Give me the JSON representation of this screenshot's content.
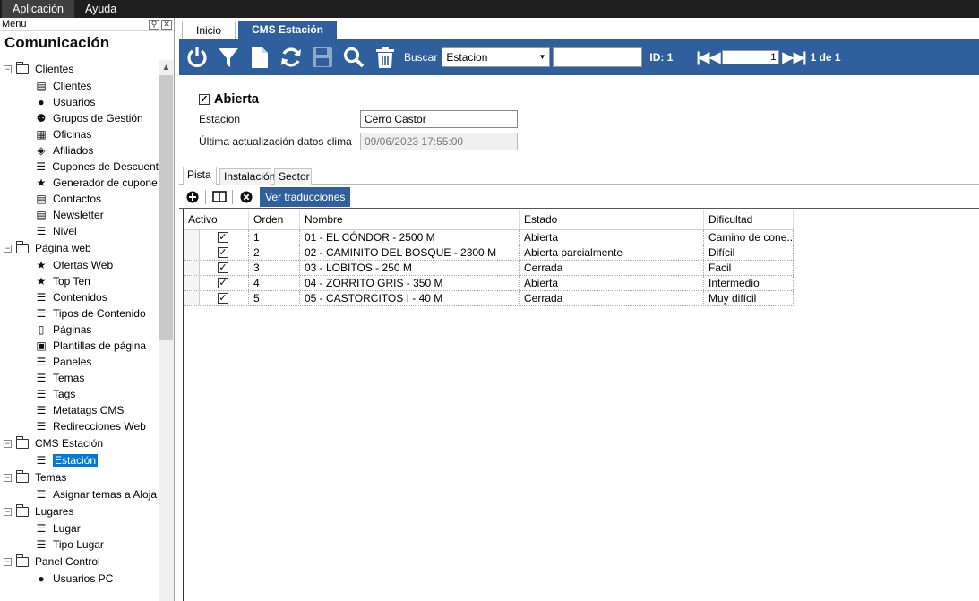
{
  "menubar": {
    "items": [
      "Aplicación",
      "Ayuda"
    ]
  },
  "left_panel": {
    "header": "Menu",
    "title": "Comunicación",
    "groups": [
      {
        "label": "Clientes",
        "items": [
          {
            "label": "Clientes",
            "icon": "client-card-icon"
          },
          {
            "label": "Usuarios",
            "icon": "user-icon"
          },
          {
            "label": "Grupos de Gestión",
            "icon": "group-icon"
          },
          {
            "label": "Oficinas",
            "icon": "building-icon"
          },
          {
            "label": "Afiliados",
            "icon": "affiliate-icon"
          },
          {
            "label": "Cupones de Descuent",
            "icon": "list-icon"
          },
          {
            "label": "Generador de cupone",
            "icon": "star-icon"
          },
          {
            "label": "Contactos",
            "icon": "client-card-icon"
          },
          {
            "label": "Newsletter",
            "icon": "client-card-icon"
          },
          {
            "label": "Nivel",
            "icon": "list-icon"
          }
        ]
      },
      {
        "label": "Página web",
        "items": [
          {
            "label": "Ofertas Web",
            "icon": "star-icon"
          },
          {
            "label": "Top Ten",
            "icon": "star-icon"
          },
          {
            "label": "Contenidos",
            "icon": "list-icon"
          },
          {
            "label": "Tipos de Contenido",
            "icon": "list-icon"
          },
          {
            "label": "Páginas",
            "icon": "page-icon"
          },
          {
            "label": "Plantillas de página",
            "icon": "template-icon"
          },
          {
            "label": "Paneles",
            "icon": "list-icon"
          },
          {
            "label": "Temas",
            "icon": "list-icon"
          },
          {
            "label": "Tags",
            "icon": "list-icon"
          },
          {
            "label": "Metatags CMS",
            "icon": "list-icon"
          },
          {
            "label": "Redirecciones Web",
            "icon": "list-icon"
          }
        ]
      },
      {
        "label": "CMS Estación",
        "items": [
          {
            "label": "Estación",
            "icon": "list-icon",
            "selected": true
          }
        ]
      },
      {
        "label": "Temas",
        "items": [
          {
            "label": "Asignar temas a Aloja",
            "icon": "list-icon"
          }
        ]
      },
      {
        "label": "Lugares",
        "items": [
          {
            "label": "Lugar",
            "icon": "list-icon"
          },
          {
            "label": "Tipo Lugar",
            "icon": "list-icon"
          }
        ]
      },
      {
        "label": "Panel Control",
        "items": [
          {
            "label": "Usuarios PC",
            "icon": "user-icon"
          }
        ]
      }
    ]
  },
  "main": {
    "tabs": [
      {
        "label": "Inicio"
      },
      {
        "label": "CMS Estación",
        "active": true
      }
    ],
    "toolbar": {
      "search_label": "Buscar",
      "search_field": "Estacion",
      "search_value": "",
      "id_label": "ID: 1",
      "page_value": "1",
      "page_of": "1 de 1",
      "color": "#2f5f9c"
    },
    "form": {
      "abierta_label": "Abierta",
      "abierta_checked": true,
      "estacion_label": "Estacion",
      "estacion_value": "Cerro Castor",
      "clima_label": "Última actualización datos clima",
      "clima_value": "09/06/2023 17:55:00"
    },
    "subtabs": [
      {
        "label": "Pista",
        "active": true
      },
      {
        "label": "Instalación"
      },
      {
        "label": "Sector"
      }
    ],
    "grid_toolbar": {
      "translations_button": "Ver traducciones"
    },
    "grid": {
      "columns": [
        "Activo",
        "Orden",
        "Nombre",
        "Estado",
        "Dificultad"
      ],
      "rows": [
        {
          "activo": true,
          "orden": "1",
          "nombre": "01 - EL CÓNDOR - 2500 M",
          "estado": "Abierta",
          "dificultad": "Camino de cone..."
        },
        {
          "activo": true,
          "orden": "2",
          "nombre": "02 - CAMINITO DEL BOSQUE - 2300 M",
          "estado": "Abierta parcialmente",
          "dificultad": "Difícil"
        },
        {
          "activo": true,
          "orden": "3",
          "nombre": "03 - LOBITOS - 250 M",
          "estado": "Cerrada",
          "dificultad": "Facil"
        },
        {
          "activo": true,
          "orden": "4",
          "nombre": "04 - ZORRITO GRIS - 350 M",
          "estado": "Abierta",
          "dificultad": "Intermedio"
        },
        {
          "activo": true,
          "orden": "5",
          "nombre": "05 - CASTORCITOS I - 40 M",
          "estado": "Cerrada",
          "dificultad": "Muy difícil"
        }
      ]
    }
  }
}
